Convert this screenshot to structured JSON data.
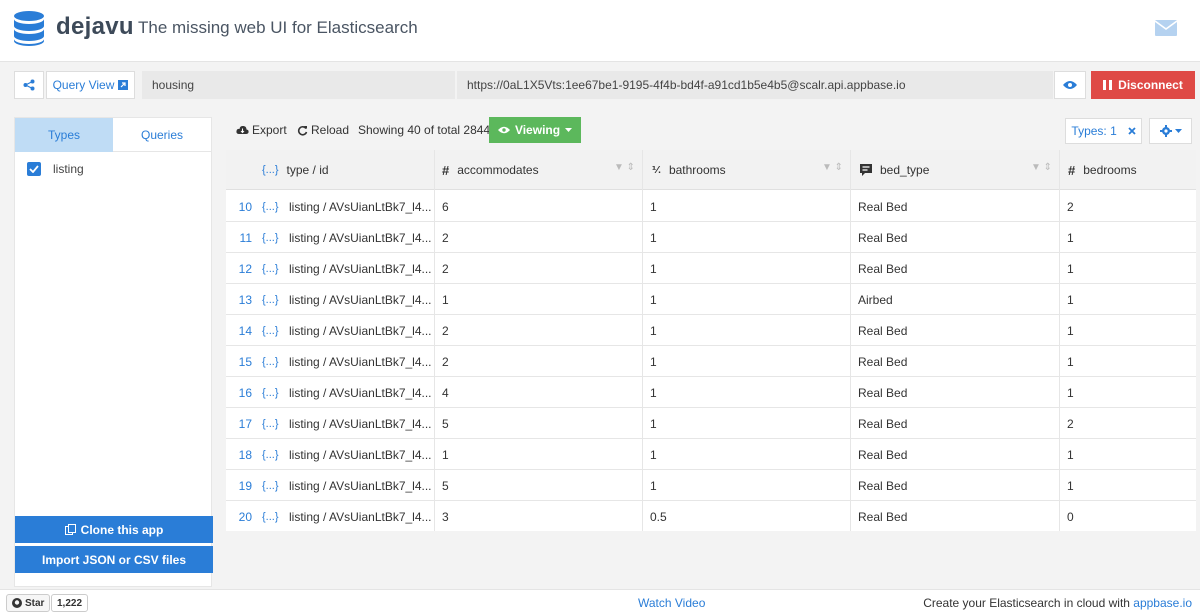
{
  "header": {
    "brand": "dejavu",
    "tagline": "The missing web UI for Elasticsearch"
  },
  "connect": {
    "query_view_label": "Query View",
    "app_name": "housing",
    "url": "https://0aL1X5Vts:1ee67be1-9195-4f4b-bd4f-a91cd1b5e4b5@scalr.api.appbase.io",
    "disconnect_label": "Disconnect"
  },
  "sidebar": {
    "tabs": [
      "Types",
      "Queries"
    ],
    "types": [
      {
        "label": "listing",
        "checked": true
      }
    ],
    "clone_label": "Clone this app",
    "import_label": "Import JSON or CSV files"
  },
  "toolbar": {
    "export_label": "Export",
    "reload_label": "Reload",
    "showing_text": "Showing 40 of total 2844",
    "viewing_label": "Viewing",
    "types_label": "Types: 1"
  },
  "table": {
    "columns": [
      {
        "label": "type / id",
        "icon": "{...}"
      },
      {
        "label": "accommodates",
        "icon": "#"
      },
      {
        "label": "bathrooms",
        "icon": "%"
      },
      {
        "label": "bed_type",
        "icon": "text-icon"
      },
      {
        "label": "bedrooms",
        "icon": "#"
      }
    ],
    "rows": [
      {
        "num": "10",
        "id": "listing / AVsUianLtBk7_l4...",
        "accommodates": "6",
        "bathrooms": "1",
        "bed_type": "Real Bed",
        "bedrooms": "2"
      },
      {
        "num": "11",
        "id": "listing / AVsUianLtBk7_l4...",
        "accommodates": "2",
        "bathrooms": "1",
        "bed_type": "Real Bed",
        "bedrooms": "1"
      },
      {
        "num": "12",
        "id": "listing / AVsUianLtBk7_l4...",
        "accommodates": "2",
        "bathrooms": "1",
        "bed_type": "Real Bed",
        "bedrooms": "1"
      },
      {
        "num": "13",
        "id": "listing / AVsUianLtBk7_l4...",
        "accommodates": "1",
        "bathrooms": "1",
        "bed_type": "Airbed",
        "bedrooms": "1"
      },
      {
        "num": "14",
        "id": "listing / AVsUianLtBk7_l4...",
        "accommodates": "2",
        "bathrooms": "1",
        "bed_type": "Real Bed",
        "bedrooms": "1"
      },
      {
        "num": "15",
        "id": "listing / AVsUianLtBk7_l4...",
        "accommodates": "2",
        "bathrooms": "1",
        "bed_type": "Real Bed",
        "bedrooms": "1"
      },
      {
        "num": "16",
        "id": "listing / AVsUianLtBk7_l4...",
        "accommodates": "4",
        "bathrooms": "1",
        "bed_type": "Real Bed",
        "bedrooms": "1"
      },
      {
        "num": "17",
        "id": "listing / AVsUianLtBk7_l4...",
        "accommodates": "5",
        "bathrooms": "1",
        "bed_type": "Real Bed",
        "bedrooms": "2"
      },
      {
        "num": "18",
        "id": "listing / AVsUianLtBk7_l4...",
        "accommodates": "1",
        "bathrooms": "1",
        "bed_type": "Real Bed",
        "bedrooms": "1"
      },
      {
        "num": "19",
        "id": "listing / AVsUianLtBk7_l4...",
        "accommodates": "5",
        "bathrooms": "1",
        "bed_type": "Real Bed",
        "bedrooms": "1"
      },
      {
        "num": "20",
        "id": "listing / AVsUianLtBk7_l4...",
        "accommodates": "3",
        "bathrooms": "0.5",
        "bed_type": "Real Bed",
        "bedrooms": "0"
      }
    ]
  },
  "footer": {
    "star_label": "Star",
    "star_count": "1,222",
    "watch_label": "Watch Video",
    "cloud_text": "Create your Elasticsearch in cloud with ",
    "cloud_link": "appbase.io"
  },
  "colors": {
    "accent": "#2a7dd7",
    "disconnect": "#df4a46",
    "viewing": "#5cb85c",
    "tab_active": "#bfdcf5"
  }
}
